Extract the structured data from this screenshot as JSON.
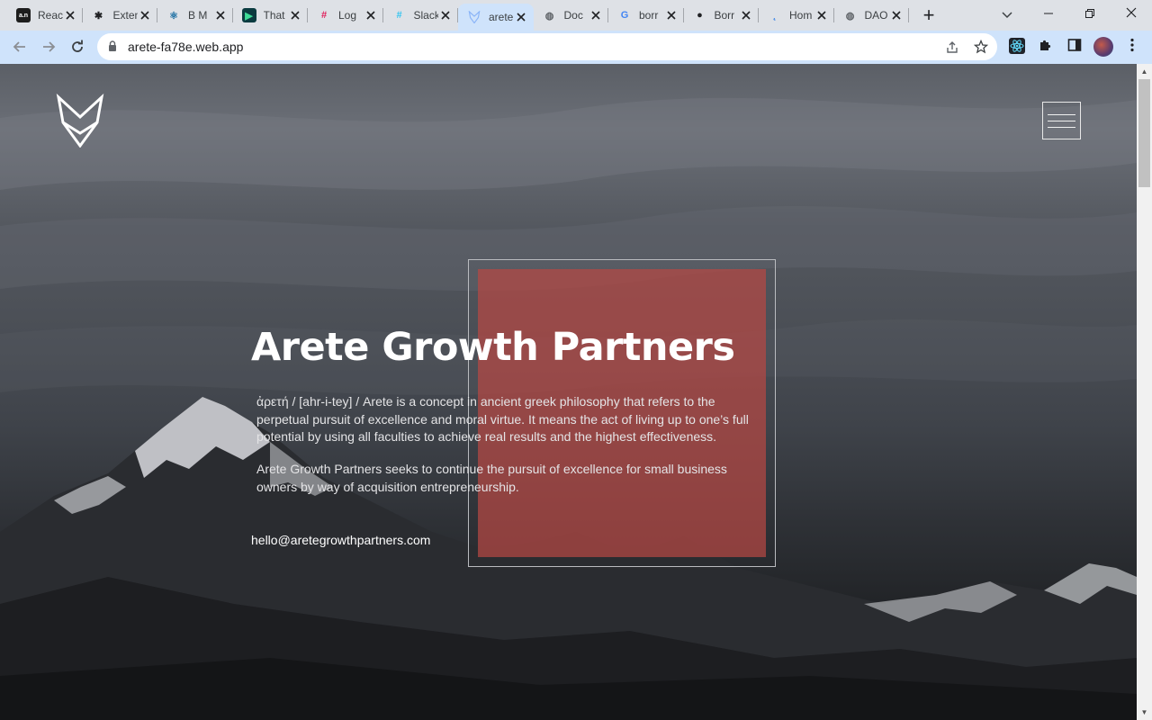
{
  "browser": {
    "tabs": [
      {
        "title": "React",
        "favicon_text": "a.n",
        "favicon_color": "#ffffff",
        "favicon_bg": "#1d1d1d",
        "icon": "app-favicon-icon"
      },
      {
        "title": "Extensions",
        "favicon_text": "✱",
        "favicon_color": "#202124",
        "favicon_bg": "transparent",
        "icon": "puzzle-piece-icon"
      },
      {
        "title": "B M",
        "favicon_text": "⚛",
        "favicon_color": "#1d6fa3",
        "favicon_bg": "transparent",
        "icon": "react-atom-icon"
      },
      {
        "title": "That",
        "favicon_text": "▶",
        "favicon_color": "#3ddc97",
        "favicon_bg": "#0b3b40",
        "icon": "play-app-icon"
      },
      {
        "title": "Log",
        "favicon_text": "#",
        "favicon_color": "#e01e5a",
        "favicon_bg": "transparent",
        "icon": "slack-icon"
      },
      {
        "title": "Slack",
        "favicon_text": "#",
        "favicon_color": "#36c5f0",
        "favicon_bg": "transparent",
        "icon": "slack-icon"
      },
      {
        "title": "arete",
        "favicon_text": "",
        "favicon_color": "#8ab4f8",
        "favicon_bg": "transparent",
        "icon": "arete-logo-icon",
        "active": true
      },
      {
        "title": "Doc",
        "favicon_text": "◍",
        "favicon_color": "#5f6368",
        "favicon_bg": "transparent",
        "icon": "globe-icon"
      },
      {
        "title": "borr",
        "favicon_text": "G",
        "favicon_color": "#4285f4",
        "favicon_bg": "transparent",
        "icon": "google-icon"
      },
      {
        "title": "Borr",
        "favicon_text": "●",
        "favicon_color": "#202124",
        "favicon_bg": "transparent",
        "icon": "github-icon"
      },
      {
        "title": "Hom",
        "favicon_text": "˛",
        "favicon_color": "#1a73e8",
        "favicon_bg": "transparent",
        "icon": "home-favicon-icon"
      },
      {
        "title": "DAO",
        "favicon_text": "◍",
        "favicon_color": "#5f6368",
        "favicon_bg": "transparent",
        "icon": "globe-icon"
      }
    ],
    "new_tab": "+",
    "tab_search": "⌄",
    "window_controls": {
      "minimize": "—",
      "restore": "❐",
      "close": "✕"
    },
    "nav": {
      "back": "←",
      "forward": "→",
      "reload": "↻"
    },
    "url": "arete-fa78e.web.app",
    "omnibox_icons": {
      "share": "⇪",
      "bookmark": "☆"
    },
    "extensions": {
      "react_devtools": "⚛",
      "extensions": "✱",
      "side_panel": "▣",
      "menu": "⋮"
    }
  },
  "page": {
    "title": "Arete Growth Partners",
    "paragraph_1": "ἀρετή / [ahr-i-tey] / Arete is a concept in ancient greek philosophy that refers to the perpetual pursuit of excellence and moral virtue. It means the act of living up to one’s full potential by using all faculties to achieve real results and the highest effectiveness.",
    "paragraph_2": "Arete Growth Partners seeks to continue the pursuit of excellence for small business owners by way of acquisition entrepreneurship.",
    "email": "hello@aretegrowthpartners.com",
    "accent_color": "#b64844"
  },
  "scrollbar": {
    "up": "▲",
    "down": "▼"
  }
}
